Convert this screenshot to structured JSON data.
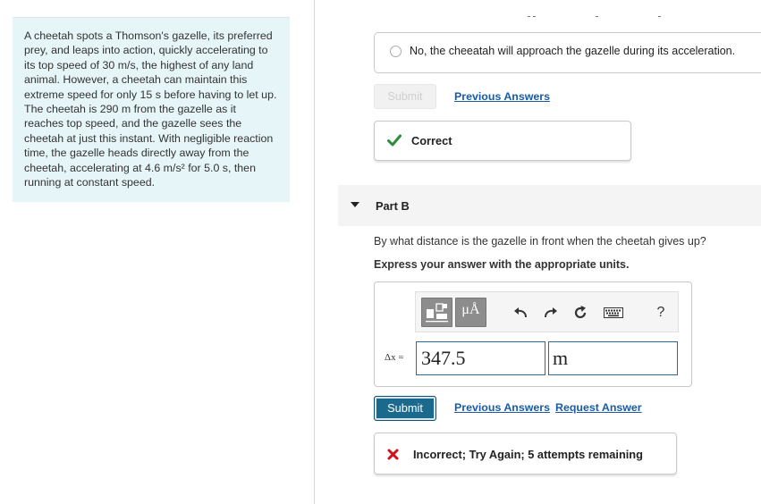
{
  "problem": {
    "lines": [
      "A cheetah spots a Thomson's gazelle, its preferred",
      "prey, and leaps into action, quickly accelerating to",
      "its top speed of 30 m/s, the highest of any land",
      "animal. However, a cheetah can maintain this",
      "extreme speed for only 15 s before having to let up.",
      "The cheetah is 290 m from the gazelle as it",
      "reaches top speed, and the gazelle sees the",
      "cheetah at just this instant. With negligible reaction",
      "time, the gazelle heads directly away from the",
      "cheetah, accelerating at 4.6 m/s² for 5.0 s, then",
      "running at constant speed."
    ]
  },
  "part_a": {
    "option_text": "No, the cheeatah will approach the gazelle during its acceleration.",
    "submit_label": "Submit",
    "previous_answers_label": "Previous Answers",
    "feedback": "Correct"
  },
  "part_b": {
    "label": "Part B",
    "question": "By what distance is the gazelle in front when the cheetah gives up?",
    "instruction": "Express your answer with the appropriate units.",
    "toolbar": {
      "units_label": "μÅ",
      "help_label": "?"
    },
    "variable_label": "Δx =",
    "value": "347.5",
    "unit": "m",
    "submit_label": "Submit",
    "previous_answers_label": "Previous Answers",
    "request_answer_label": "Request Answer",
    "feedback": "Incorrect; Try Again; 5 attempts remaining"
  },
  "colors": {
    "problem_bg": "#e6f5f8",
    "link": "#1a5aa6",
    "correct": "#2e8b3d",
    "incorrect": "#d0101a",
    "submit_bg": "#1b6a8e"
  }
}
